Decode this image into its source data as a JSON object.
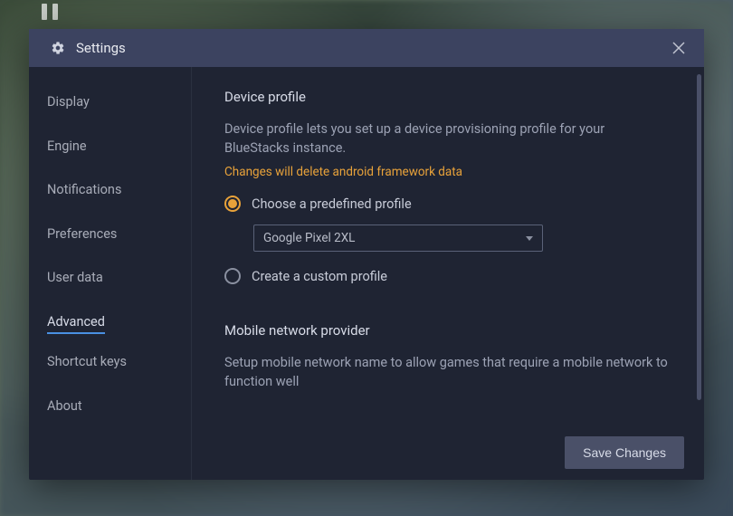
{
  "header": {
    "title": "Settings"
  },
  "sidebar": {
    "items": [
      {
        "label": "Display",
        "active": false
      },
      {
        "label": "Engine",
        "active": false
      },
      {
        "label": "Notifications",
        "active": false
      },
      {
        "label": "Preferences",
        "active": false
      },
      {
        "label": "User data",
        "active": false
      },
      {
        "label": "Advanced",
        "active": true
      },
      {
        "label": "Shortcut keys",
        "active": false
      },
      {
        "label": "About",
        "active": false
      }
    ]
  },
  "content": {
    "device_profile": {
      "title": "Device profile",
      "description": "Device profile lets you set up a device provisioning profile for your BlueStacks instance.",
      "warning": "Changes will delete android framework data",
      "option_predefined": "Choose a predefined profile",
      "option_custom": "Create a custom profile",
      "selected_profile": "Google Pixel 2XL"
    },
    "mobile_network": {
      "title": "Mobile network provider",
      "description": "Setup mobile network name to allow games that require a mobile network to function well"
    }
  },
  "footer": {
    "save_label": "Save Changes"
  }
}
